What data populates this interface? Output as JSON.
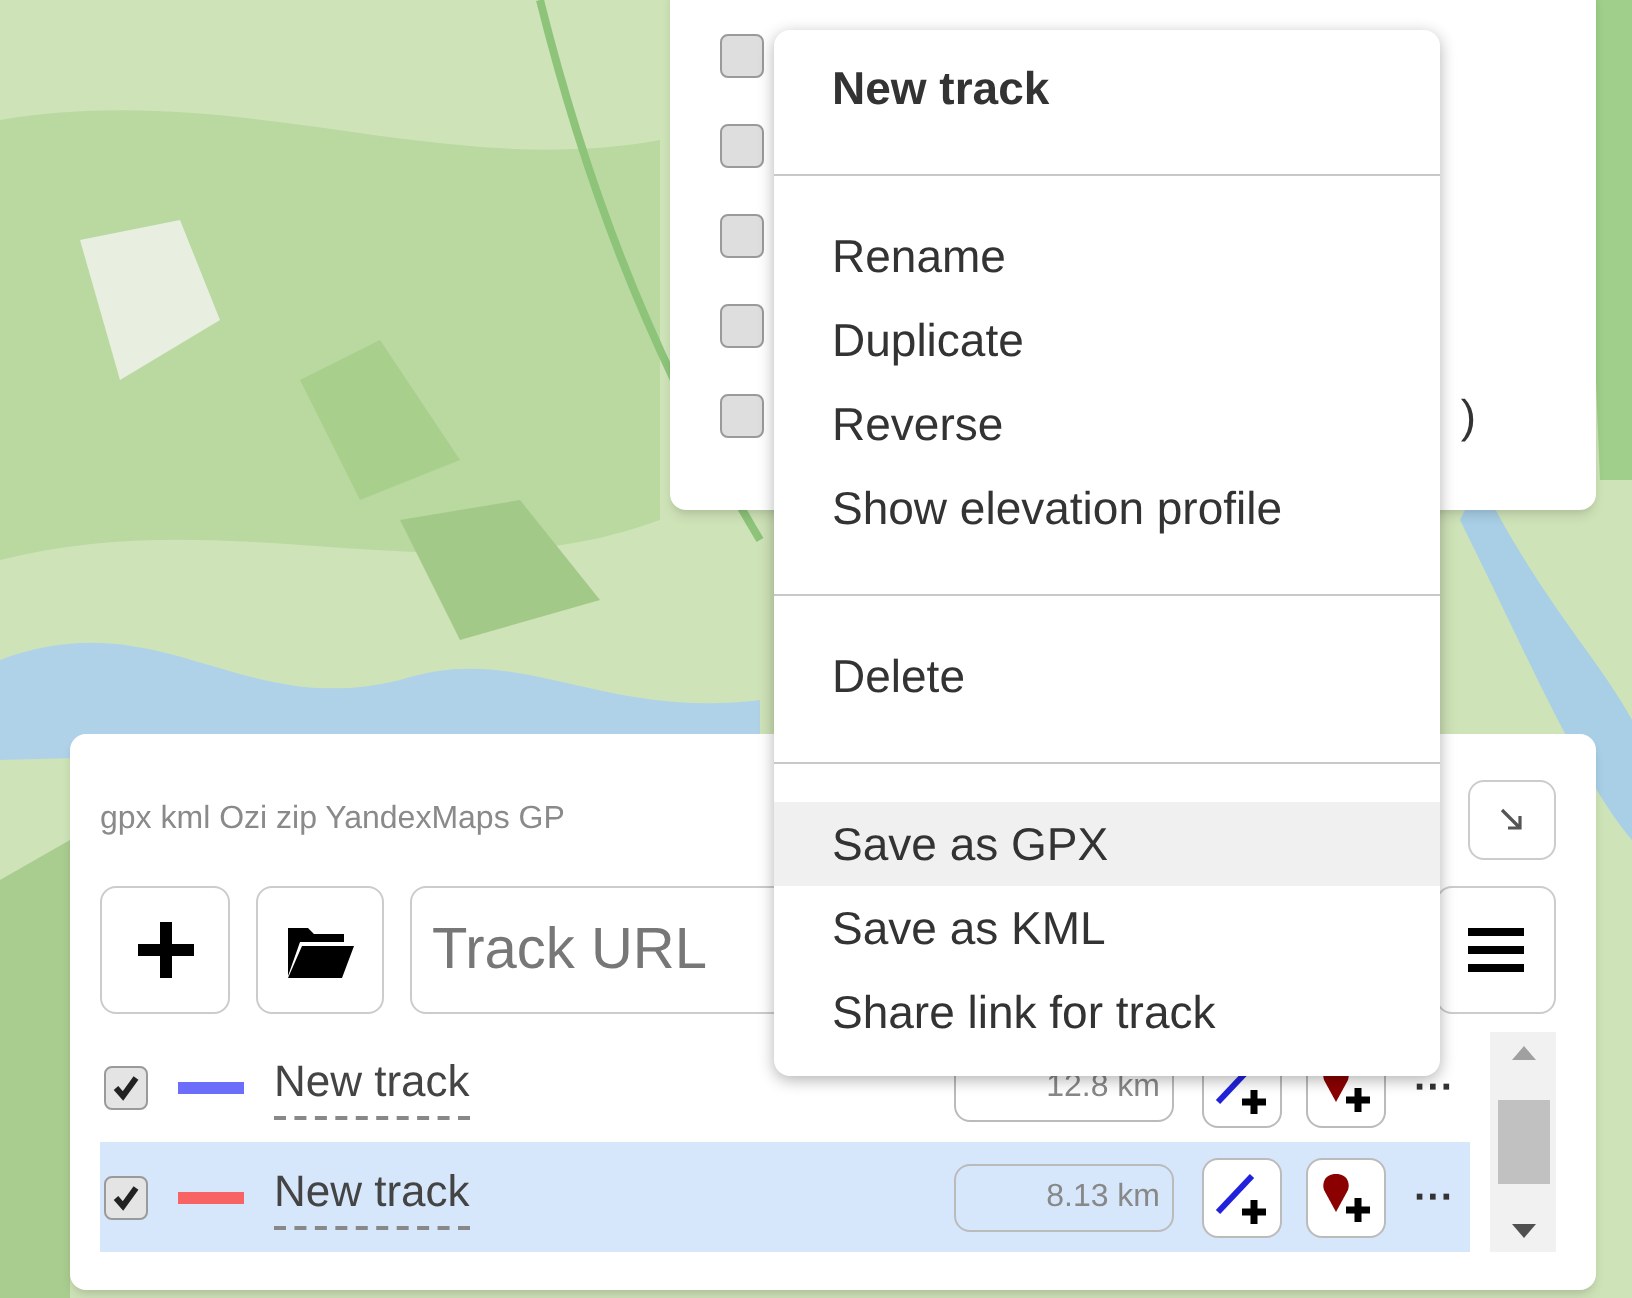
{
  "top_panel": {
    "checkboxes": [
      {
        "checked": false
      },
      {
        "checked": false
      },
      {
        "checked": false
      },
      {
        "checked": false
      },
      {
        "checked": false
      }
    ],
    "fragment": ")"
  },
  "context_menu": {
    "title": "New track",
    "groups": [
      {
        "items": [
          {
            "label": "Rename",
            "selected": false
          },
          {
            "label": "Duplicate",
            "selected": false
          },
          {
            "label": "Reverse",
            "selected": false
          },
          {
            "label": "Show elevation profile",
            "selected": false
          }
        ]
      },
      {
        "items": [
          {
            "label": "Delete",
            "selected": false
          }
        ]
      },
      {
        "items": [
          {
            "label": "Save as GPX",
            "selected": true
          },
          {
            "label": "Save as KML",
            "selected": false
          },
          {
            "label": "Share link for track",
            "selected": false
          }
        ]
      }
    ]
  },
  "track_panel": {
    "formats": "gpx kml Ozi zip YandexMaps GP",
    "url_field": {
      "placeholder": "Track URL"
    },
    "more_label": "···",
    "tracks": [
      {
        "name": "New track",
        "checked": true,
        "color": "#6d6dfb",
        "distance": "12.8 km",
        "selected": false
      },
      {
        "name": "New track",
        "checked": true,
        "color": "#f86464",
        "distance": "8.13 km",
        "selected": true
      }
    ]
  }
}
